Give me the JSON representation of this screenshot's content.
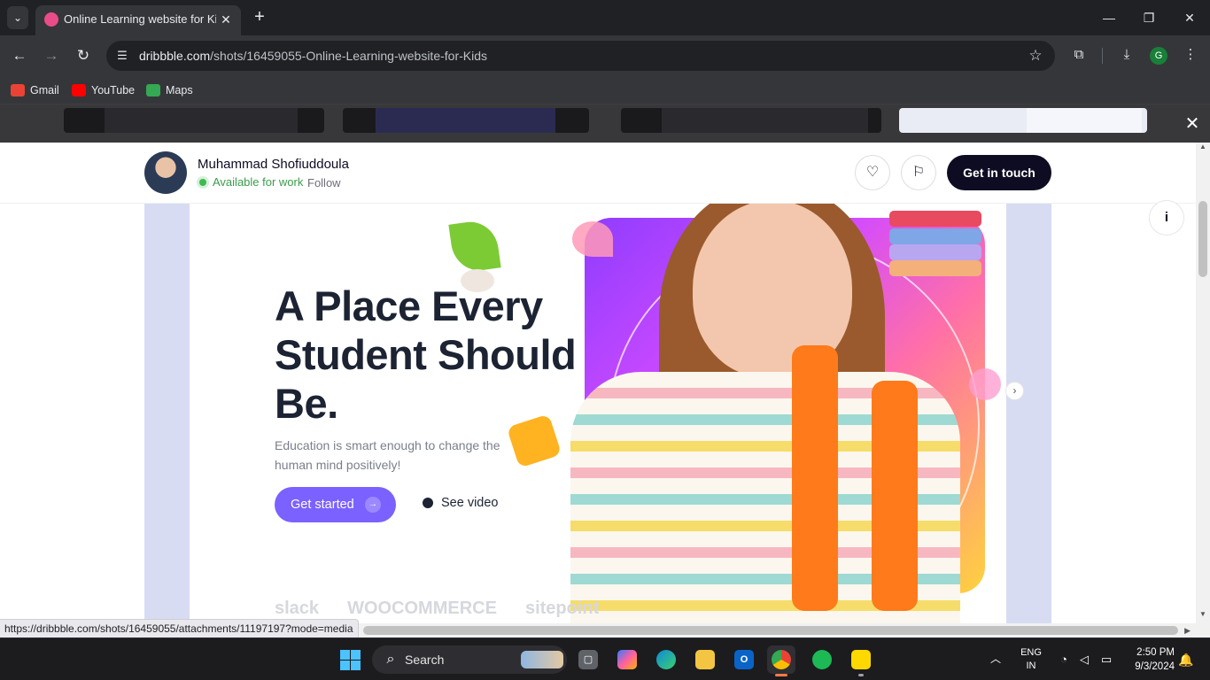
{
  "browser": {
    "tab": {
      "title": "Online Learning website for Kids",
      "close": "✕"
    },
    "new_tab": "+",
    "window": {
      "minimize": "—",
      "maximize": "❐",
      "close": "✕"
    },
    "nav": {
      "back": "←",
      "forward": "→",
      "reload": "↻"
    },
    "url": {
      "host": "dribbble.com",
      "path": "/shots/16459055-Online-Learning-website-for-Kids"
    },
    "bookmarks": [
      {
        "label": "Gmail",
        "color": "#ea4335"
      },
      {
        "label": "YouTube",
        "color": "#ff0000"
      },
      {
        "label": "Maps",
        "color": "#34a853"
      }
    ],
    "profile_initial": "G",
    "status_link": "https://dribbble.com/shots/16459055/attachments/11197197?mode=media"
  },
  "shot_header": {
    "author": "Muhammad Shofiuddoula",
    "availability": "Available for work",
    "follow": "Follow",
    "get_in_touch": "Get in touch"
  },
  "shot": {
    "headline": "A Place Every Student Should Be.",
    "subtitle": "Education is smart enough to change the human mind positively!",
    "cta_primary": "Get started",
    "cta_secondary": "See video",
    "brands": [
      "slack",
      "WOOCOMMERCE",
      "sitepoint"
    ],
    "accent_color": "#7b61ff"
  },
  "taskbar": {
    "search_label": "Search",
    "lang_line1": "ENG",
    "lang_line2": "IN",
    "time": "2:50 PM",
    "date": "9/3/2024"
  },
  "icons": [
    "heart-icon",
    "bookmark-icon",
    "info-icon",
    "close-icon",
    "star-icon",
    "extensions-icon",
    "download-icon",
    "menu-icon"
  ]
}
